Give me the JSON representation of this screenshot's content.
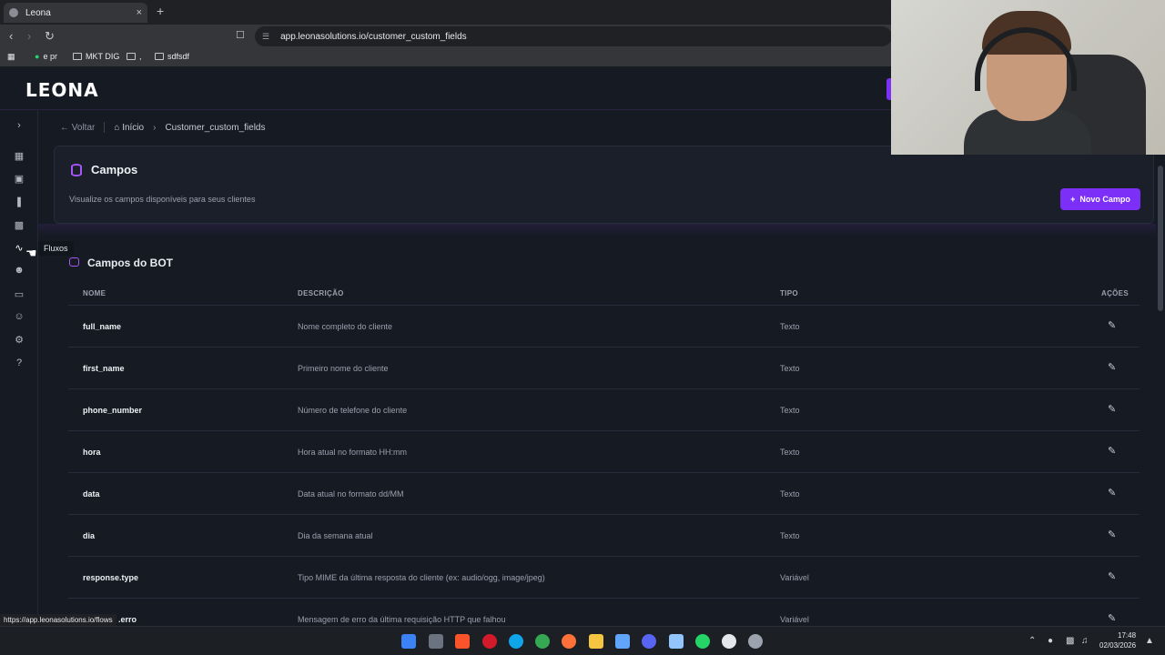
{
  "browser": {
    "tab_title": "Leona",
    "tab_close": "×",
    "new_tab": "+",
    "url": "app.leonasolutions.io/customer_custom_fields",
    "bookmarks": [
      {
        "label": "e pr"
      },
      {
        "label": "MKT DIG"
      },
      {
        "label": ","
      },
      {
        "label": "sdfsdf"
      }
    ],
    "status_url": "https://app.leonasolutions.io/flows"
  },
  "app": {
    "logo": "LEONA",
    "sidebar_tooltip": "Fluxos",
    "breadcrumb": {
      "back": "Voltar",
      "home": "Início",
      "current": "Customer_custom_fields"
    },
    "card": {
      "title": "Campos",
      "subtitle": "Visualize os campos disponíveis para seus clientes",
      "new_button": "Novo Campo"
    },
    "section_title": "Campos do BOT",
    "table": {
      "headers": {
        "name": "NOME",
        "description": "DESCRIÇÃO",
        "type": "TIPO",
        "actions": "AÇÕES"
      },
      "rows": [
        {
          "name": "full_name",
          "description": "Nome completo do cliente",
          "type": "Texto"
        },
        {
          "name": "first_name",
          "description": "Primeiro nome do cliente",
          "type": "Texto"
        },
        {
          "name": "phone_number",
          "description": "Número de telefone do cliente",
          "type": "Texto"
        },
        {
          "name": "hora",
          "description": "Hora atual no formato HH:mm",
          "type": "Texto"
        },
        {
          "name": "data",
          "description": "Data atual no formato dd/MM",
          "type": "Texto"
        },
        {
          "name": "dia",
          "description": "Dia da semana atual",
          "type": "Texto"
        },
        {
          "name": "response.type",
          "description": "Tipo MIME da última resposta do cliente (ex: audio/ogg, image/jpeg)",
          "type": "Variável"
        },
        {
          "name": ".erro",
          "description": "Mensagem de erro da última requisição HTTP que falhou",
          "type": "Variável"
        }
      ]
    }
  },
  "taskbar": {
    "time": "17:48",
    "date": "02/03/2026"
  },
  "colors": {
    "accent": "#7b2ff7",
    "icon_accent": "#a855f7",
    "background": "#151a23"
  }
}
